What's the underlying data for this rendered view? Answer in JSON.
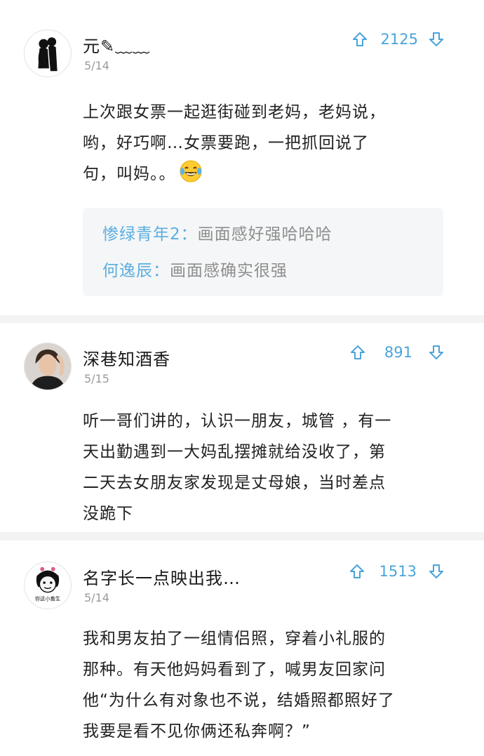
{
  "comments": [
    {
      "username": "元✎﹏﹏",
      "date": "5/14",
      "votes": "2125",
      "lines": [
        "上次跟女票一起逛街碰到老妈，老妈说，",
        "哟，好巧啊…女票要跑，一把抓回说了",
        "句，叫妈。。"
      ],
      "emoji": "laughing-tears-emoji",
      "replies": [
        {
          "name": "惨绿青年2",
          "sep": "：",
          "text": "画面感好强哈哈哈"
        },
        {
          "name": "何逸辰",
          "sep": "：",
          "text": "画面感确实很强"
        }
      ]
    },
    {
      "username": "深巷知酒香",
      "date": "5/15",
      "votes": "891",
      "lines": [
        "听一哥们讲的，认识一朋友，城管 ，有一",
        "天出勤遇到一大妈乱摆摊就给没收了，第",
        "二天去女朋友家发现是丈母娘，当时差点",
        "没跪下"
      ]
    },
    {
      "username": "名字长一点映出我…",
      "date": "5/14",
      "votes": "1513",
      "avatar_text": "你这小畜生",
      "lines": [
        "我和男友拍了一组情侣照，穿着小礼服的",
        "那种。有天他妈妈看到了，喊男友回家问",
        "他“为什么有对象也不说，结婚照都照好了",
        "我要是看不见你俩还私奔啊？”"
      ]
    }
  ],
  "icons": {
    "upvote": "arrow-up-icon",
    "downvote": "arrow-down-icon"
  },
  "colors": {
    "accent": "#4aa4da",
    "reply_name": "#5aaee0",
    "reply_text": "#8e8e8e",
    "background": "#f3f3f3"
  }
}
